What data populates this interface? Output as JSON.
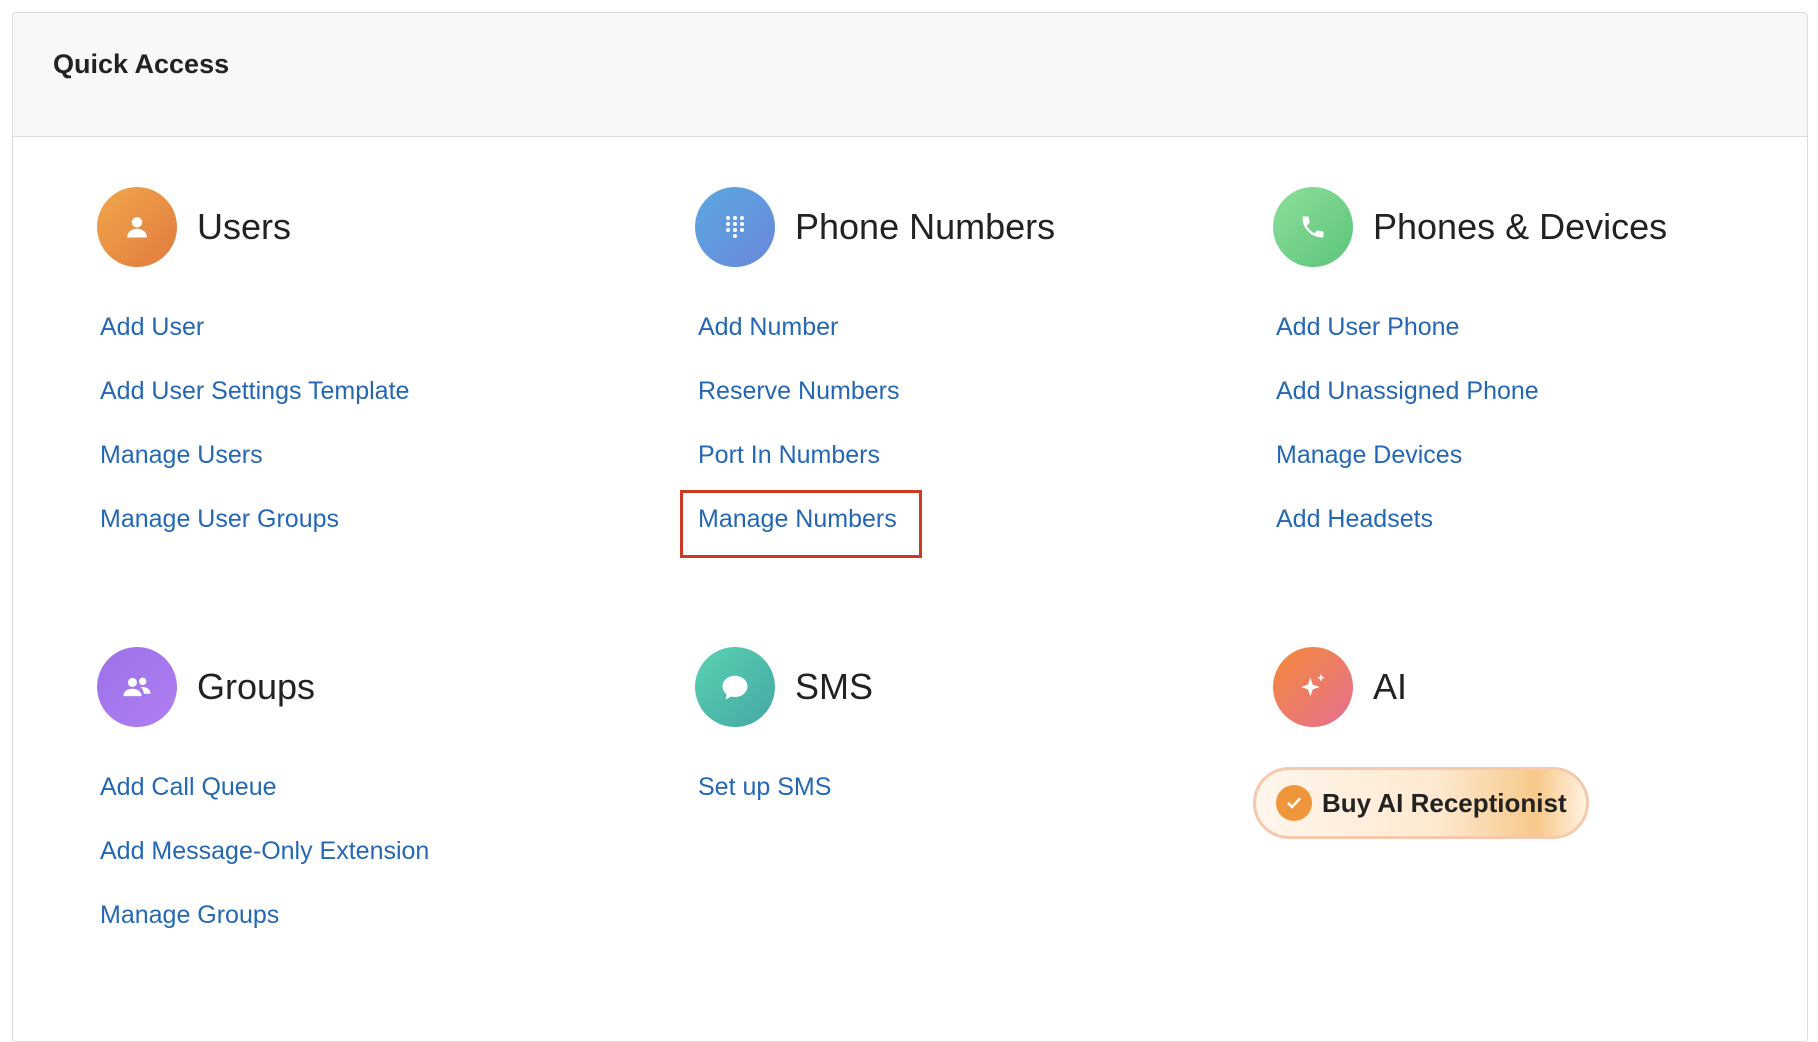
{
  "header": {
    "title": "Quick Access"
  },
  "sections": {
    "users": {
      "title": "Users",
      "icon": "user-icon",
      "links": [
        "Add User",
        "Add User Settings Template",
        "Manage Users",
        "Manage User Groups"
      ]
    },
    "phone_numbers": {
      "title": "Phone Numbers",
      "icon": "dialpad-icon",
      "links": [
        "Add Number",
        "Reserve Numbers",
        "Port In Numbers",
        "Manage Numbers"
      ]
    },
    "phones_devices": {
      "title": "Phones & Devices",
      "icon": "phone-icon",
      "links": [
        "Add User Phone",
        "Add Unassigned Phone",
        "Manage Devices",
        "Add Headsets"
      ]
    },
    "groups": {
      "title": "Groups",
      "icon": "group-icon",
      "links": [
        "Add Call Queue",
        "Add Message-Only Extension",
        "Manage Groups"
      ]
    },
    "sms": {
      "title": "SMS",
      "icon": "chat-bubble-icon",
      "links": [
        "Set up SMS"
      ]
    },
    "ai": {
      "title": "AI",
      "icon": "sparkle-icon",
      "button_label": "Buy AI Receptionist"
    }
  },
  "highlight_color": "#cc3a25",
  "link_color": "#2467b4"
}
